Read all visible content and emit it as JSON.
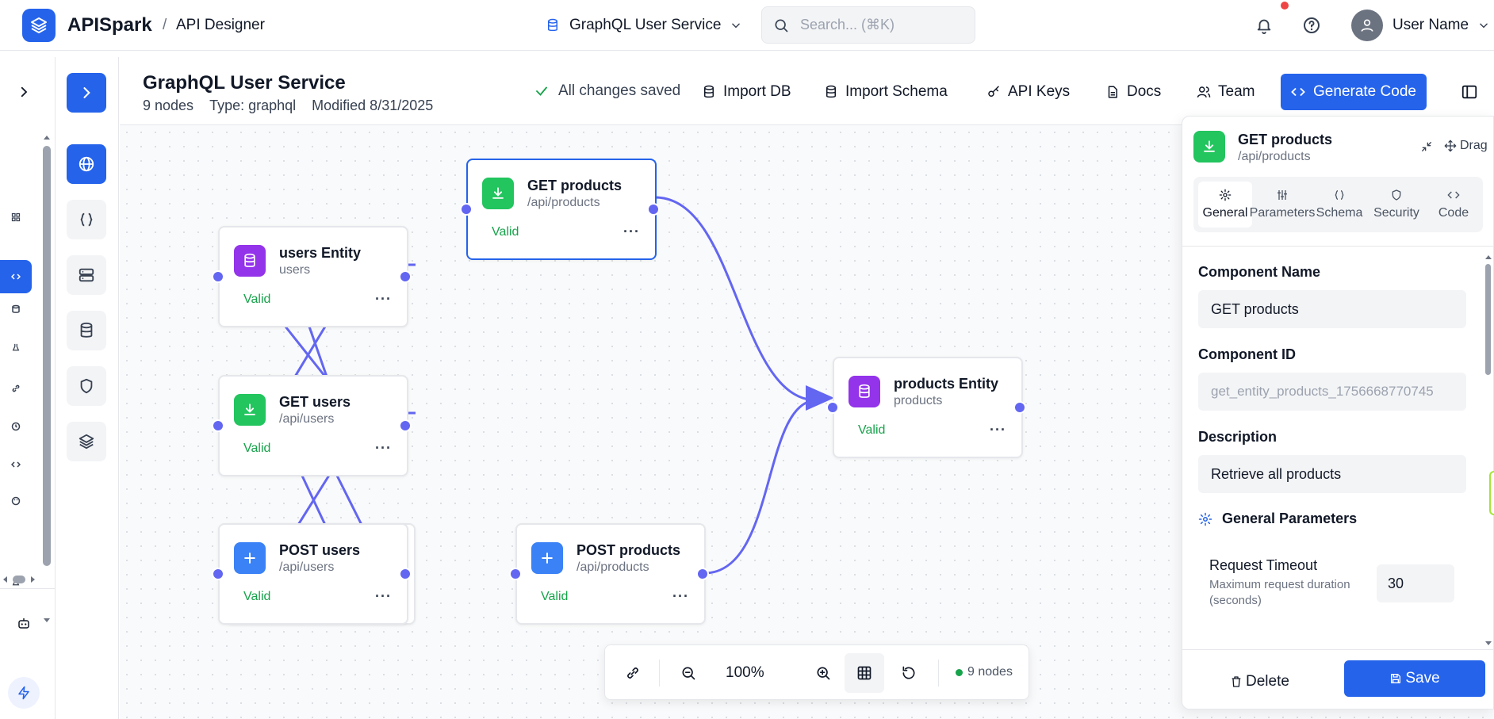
{
  "app": {
    "brand": "APISpark",
    "breadcrumb_sep": "/",
    "breadcrumb": "API Designer",
    "service_select": "GraphQL User Service",
    "search_placeholder": "Search... (⌘K)",
    "user_name": "User Name"
  },
  "colors": {
    "primary": "#2563eb",
    "entity": "#9333ea",
    "get": "#22c55e",
    "post": "#3b82f6",
    "edge": "#6366f1",
    "valid": "#16a34a"
  },
  "project": {
    "title": "GraphQL User Service",
    "node_count": "9 nodes",
    "type": "Type: graphql",
    "modified": "Modified 8/31/2025",
    "saved_status": "All changes saved"
  },
  "toolbar": {
    "import_db": "Import DB",
    "import_schema": "Import Schema",
    "api_keys": "API Keys",
    "docs": "Docs",
    "team": "Team",
    "generate_code": "Generate Code"
  },
  "nodes": [
    {
      "id": "get-products",
      "title": "GET products",
      "subtitle": "/api/products",
      "status": "Valid",
      "kind": "get"
    },
    {
      "id": "users-entity",
      "title": "users Entity",
      "subtitle": "users",
      "status": "Valid",
      "kind": "entity"
    },
    {
      "id": "get-users",
      "title": "GET users",
      "subtitle": "/api/users",
      "status": "Valid",
      "kind": "get"
    },
    {
      "id": "post-users",
      "title": "POST users",
      "subtitle": "/api/users",
      "status": "Valid",
      "kind": "post"
    },
    {
      "id": "post-products",
      "title": "POST products",
      "subtitle": "/api/products",
      "status": "Valid",
      "kind": "post"
    },
    {
      "id": "products-entity",
      "title": "products Entity",
      "subtitle": "products",
      "status": "Valid",
      "kind": "entity"
    }
  ],
  "node_more": "···",
  "zoom": {
    "level": "100%",
    "node_count": "9 nodes"
  },
  "panel": {
    "title": "GET products",
    "subtitle": "/api/products",
    "drag_label": "Drag",
    "tabs": [
      {
        "label": "General",
        "icon": "gear-icon"
      },
      {
        "label": "Parameters",
        "icon": "sliders-icon"
      },
      {
        "label": "Schema",
        "icon": "braces-icon"
      },
      {
        "label": "Security",
        "icon": "shield-icon"
      },
      {
        "label": "Code",
        "icon": "code-icon"
      }
    ],
    "component_name_label": "Component Name",
    "component_name": "GET products",
    "component_id_label": "Component ID",
    "component_id": "get_entity_products_1756668770745",
    "description_label": "Description",
    "description": "Retrieve all products",
    "general_params_label": "General Parameters",
    "timeout_label": "Request Timeout",
    "timeout_help": "Maximum request duration (seconds)",
    "timeout_value": "30",
    "delete_label": "Delete",
    "save_label": "Save"
  }
}
